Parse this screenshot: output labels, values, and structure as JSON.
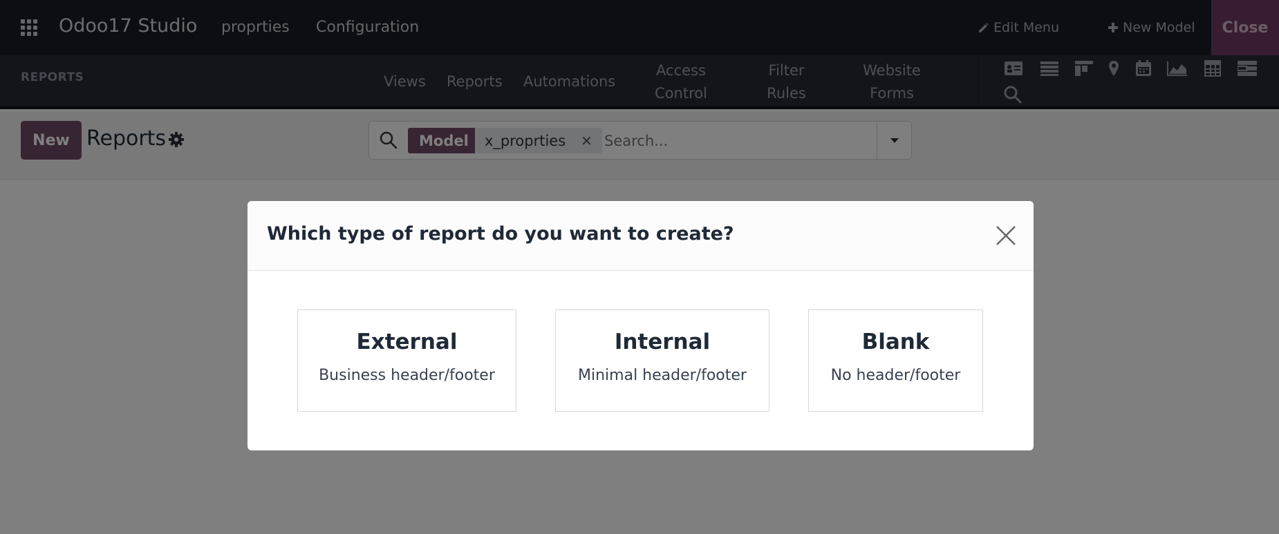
{
  "topbar": {
    "brand": "Odoo17 Studio",
    "menu": [
      "proprties",
      "Configuration"
    ],
    "edit_menu": "Edit Menu",
    "new_model": "New Model",
    "close": "Close"
  },
  "studio_bar": {
    "title": "REPORTS",
    "tabs": [
      "Views",
      "Reports",
      "Automations",
      "Access Control",
      "Filter Rules",
      "Website Forms"
    ],
    "view_icons": [
      "form-view-icon",
      "list-view-icon",
      "kanban-view-icon",
      "map-view-icon",
      "calendar-view-icon",
      "graph-view-icon",
      "pivot-view-icon",
      "gantt-view-icon",
      "search-view-icon"
    ]
  },
  "control_panel": {
    "new_button": "New",
    "title": "Reports",
    "search": {
      "facet_label": "Model",
      "facet_value": "x_proprties",
      "placeholder": "Search..."
    }
  },
  "dialog": {
    "title": "Which type of report do you want to create?",
    "options": [
      {
        "title": "External",
        "subtitle": "Business header/footer"
      },
      {
        "title": "Internal",
        "subtitle": "Minimal header/footer"
      },
      {
        "title": "Blank",
        "subtitle": "No header/footer"
      }
    ]
  },
  "colors": {
    "brand_purple": "#714b67",
    "topbar_bg": "#1a1d26",
    "studio_bar_bg": "#262a36"
  }
}
